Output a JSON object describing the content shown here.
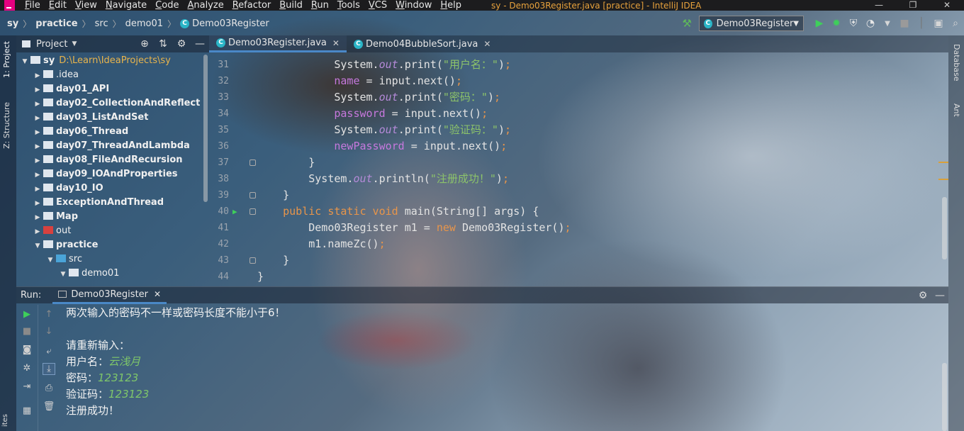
{
  "menubar": {
    "items": [
      "File",
      "Edit",
      "View",
      "Navigate",
      "Code",
      "Analyze",
      "Refactor",
      "Build",
      "Run",
      "Tools",
      "VCS",
      "Window",
      "Help"
    ],
    "window_title": "sy - Demo03Register.java [practice] - IntelliJ IDEA",
    "minimize": "—",
    "restore": "❐",
    "close": "✕"
  },
  "navbar": {
    "crumbs": [
      "sy",
      "practice",
      "src",
      "demo01",
      "Demo03Register"
    ],
    "run_config": "Demo03Register"
  },
  "left_stripe": {
    "project_tab": "1: Project",
    "structure_tab": "Z: Structure",
    "favorites_tab": "ites"
  },
  "right_stripe": {
    "database_tab": "Database",
    "ant_tab": "Ant"
  },
  "project_panel": {
    "title": "Project",
    "tree": [
      {
        "name": "sy",
        "path": "D:\\Learn\\IdeaProjects\\sy",
        "level": 0,
        "expanded": true,
        "kind": "module"
      },
      {
        "name": ".idea",
        "level": 1,
        "expanded": false,
        "kind": "folder"
      },
      {
        "name": "day01_API",
        "level": 1,
        "expanded": false,
        "kind": "module"
      },
      {
        "name": "day02_CollectionAndReflect",
        "level": 1,
        "expanded": false,
        "kind": "module"
      },
      {
        "name": "day03_ListAndSet",
        "level": 1,
        "expanded": false,
        "kind": "module"
      },
      {
        "name": "day06_Thread",
        "level": 1,
        "expanded": false,
        "kind": "module"
      },
      {
        "name": "day07_ThreadAndLambda",
        "level": 1,
        "expanded": false,
        "kind": "module"
      },
      {
        "name": "day08_FileAndRecursion",
        "level": 1,
        "expanded": false,
        "kind": "module"
      },
      {
        "name": "day09_IOAndProperties",
        "level": 1,
        "expanded": false,
        "kind": "module"
      },
      {
        "name": "day10_IO",
        "level": 1,
        "expanded": false,
        "kind": "module"
      },
      {
        "name": "ExceptionAndThread",
        "level": 1,
        "expanded": false,
        "kind": "module"
      },
      {
        "name": "Map",
        "level": 1,
        "expanded": false,
        "kind": "module"
      },
      {
        "name": "out",
        "level": 1,
        "expanded": false,
        "kind": "out"
      },
      {
        "name": "practice",
        "level": 1,
        "expanded": true,
        "kind": "module"
      },
      {
        "name": "src",
        "level": 2,
        "expanded": true,
        "kind": "src"
      },
      {
        "name": "demo01",
        "level": 3,
        "expanded": true,
        "kind": "package"
      }
    ]
  },
  "editor": {
    "tabs": [
      {
        "label": "Demo03Register.java",
        "active": true
      },
      {
        "label": "Demo04BubbleSort.java",
        "active": false
      }
    ],
    "lines": [
      {
        "n": "31",
        "html": "            System.<span class=\"f\">out</span>.print(<span class=\"s\">\"用户名：\"</span>)<span class=\"k\">;</span>"
      },
      {
        "n": "32",
        "html": "            <span class=\"v\">name</span> = input.next()<span class=\"k\">;</span>"
      },
      {
        "n": "33",
        "html": "            System.<span class=\"f\">out</span>.print(<span class=\"s\">\"密码：\"</span>)<span class=\"k\">;</span>"
      },
      {
        "n": "34",
        "html": "            <span class=\"v\">password</span> = input.next()<span class=\"k\">;</span>"
      },
      {
        "n": "35",
        "html": "            System.<span class=\"f\">out</span>.print(<span class=\"s\">\"验证码：\"</span>)<span class=\"k\">;</span>"
      },
      {
        "n": "36",
        "html": "            <span class=\"v\">newPassword</span> = input.next()<span class=\"k\">;</span>"
      },
      {
        "n": "37",
        "html": "        }"
      },
      {
        "n": "38",
        "html": "        System.<span class=\"f\">out</span>.println(<span class=\"s\">\"注册成功！\"</span>)<span class=\"k\">;</span>"
      },
      {
        "n": "39",
        "html": "    }"
      },
      {
        "n": "40",
        "html": "    <span class=\"k\">public static void</span> main(String[] args) {"
      },
      {
        "n": "41",
        "html": "        Demo03Register m1 = <span class=\"k\">new</span> Demo03Register()<span class=\"k\">;</span>"
      },
      {
        "n": "42",
        "html": "        m1.nameZc()<span class=\"k\">;</span>"
      },
      {
        "n": "43",
        "html": "    }"
      },
      {
        "n": "44",
        "html": "}"
      }
    ]
  },
  "run_panel": {
    "label": "Run:",
    "tab": "Demo03Register",
    "console": [
      {
        "text": "两次输入的密码不一样或密码长度不能小于6！",
        "input": ""
      },
      {
        "text": "",
        "input": ""
      },
      {
        "text": "请重新输入：",
        "input": ""
      },
      {
        "text": "用户名：",
        "input": "云浅月"
      },
      {
        "text": "密码：",
        "input": "123123"
      },
      {
        "text": "验证码：",
        "input": "123123"
      },
      {
        "text": "注册成功！",
        "input": ""
      }
    ]
  },
  "colors": {
    "accent": "#4a88c7",
    "keyword": "#e8954a",
    "string": "#8cc36a",
    "field": "#c678dd",
    "run_green": "#3ecf5a",
    "title_orange": "#e8a23c"
  }
}
